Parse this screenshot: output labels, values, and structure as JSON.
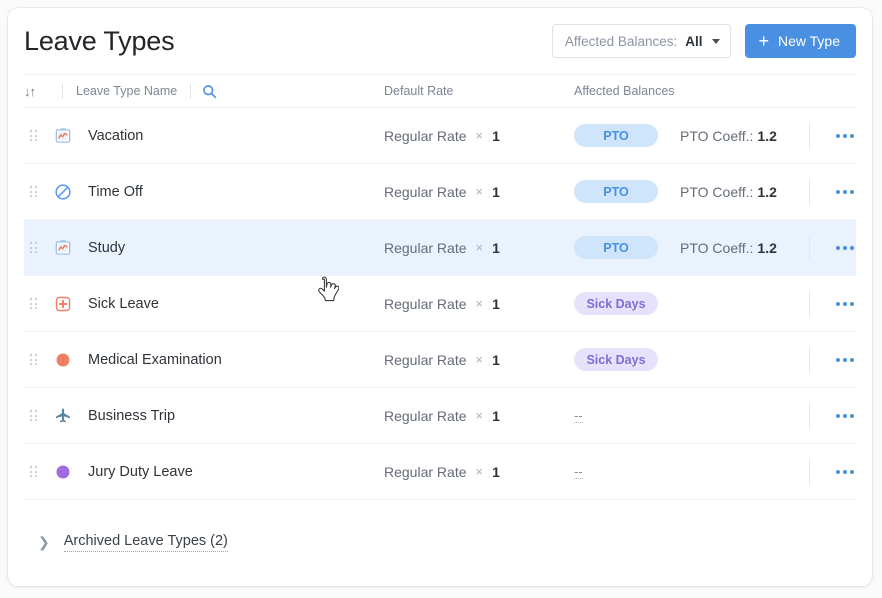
{
  "header": {
    "title": "Leave Types",
    "filter": {
      "label": "Affected Balances:",
      "value": "All",
      "caret_icon": "chevron-down-icon"
    },
    "new_button": {
      "label": "New Type",
      "icon": "plus-icon",
      "color": "#4a90e2"
    }
  },
  "table": {
    "columns": {
      "sort_icon": "↓↑",
      "name": "Leave Type Name",
      "search_icon": "search-icon",
      "rate": "Default Rate",
      "balances": "Affected Balances"
    },
    "rate_separator": "×",
    "empty_value": "--",
    "rows": [
      {
        "icon": "clipboard-chart-icon",
        "name": "Vacation",
        "rate": "Regular Rate",
        "multiplier": "1",
        "badge": "PTO",
        "badge_kind": "pto",
        "coeff_label": "PTO Coeff.:",
        "coeff_value": "1.2",
        "highlighted": false
      },
      {
        "icon": "no-entry-icon",
        "name": "Time Off",
        "rate": "Regular Rate",
        "multiplier": "1",
        "badge": "PTO",
        "badge_kind": "pto",
        "coeff_label": "PTO Coeff.:",
        "coeff_value": "1.2",
        "highlighted": false
      },
      {
        "icon": "clipboard-chart-icon",
        "name": "Study",
        "rate": "Regular Rate",
        "multiplier": "1",
        "badge": "PTO",
        "badge_kind": "pto",
        "coeff_label": "PTO Coeff.:",
        "coeff_value": "1.2",
        "highlighted": true
      },
      {
        "icon": "medical-cross-icon",
        "name": "Sick Leave",
        "rate": "Regular Rate",
        "multiplier": "1",
        "badge": "Sick Days",
        "badge_kind": "sick",
        "coeff_label": "",
        "coeff_value": "",
        "highlighted": false
      },
      {
        "icon": "circle-orange-icon",
        "name": "Medical Examination",
        "rate": "Regular Rate",
        "multiplier": "1",
        "badge": "Sick Days",
        "badge_kind": "sick",
        "coeff_label": "",
        "coeff_value": "",
        "highlighted": false
      },
      {
        "icon": "airplane-icon",
        "name": "Business Trip",
        "rate": "Regular Rate",
        "multiplier": "1",
        "badge": "",
        "badge_kind": "none",
        "coeff_label": "",
        "coeff_value": "",
        "highlighted": false
      },
      {
        "icon": "circle-purple-icon",
        "name": "Jury Duty Leave",
        "rate": "Regular Rate",
        "multiplier": "1",
        "badge": "",
        "badge_kind": "none",
        "coeff_label": "",
        "coeff_value": "",
        "highlighted": false
      }
    ]
  },
  "footer": {
    "chevron_icon": "chevron-right-icon",
    "archived_label": "Archived Leave Types (2)"
  },
  "colors": {
    "accent": "#4a90e2",
    "badge_pto_bg": "#cfe5fb",
    "badge_pto_text": "#4a90e2",
    "badge_sick_bg": "#e7e2fb",
    "badge_sick_text": "#7b6fd6",
    "row_highlight": "#eaf3fd",
    "icon_salmon": "#ef8063",
    "icon_purple": "#a06ae0",
    "icon_steel": "#5b87a8"
  }
}
